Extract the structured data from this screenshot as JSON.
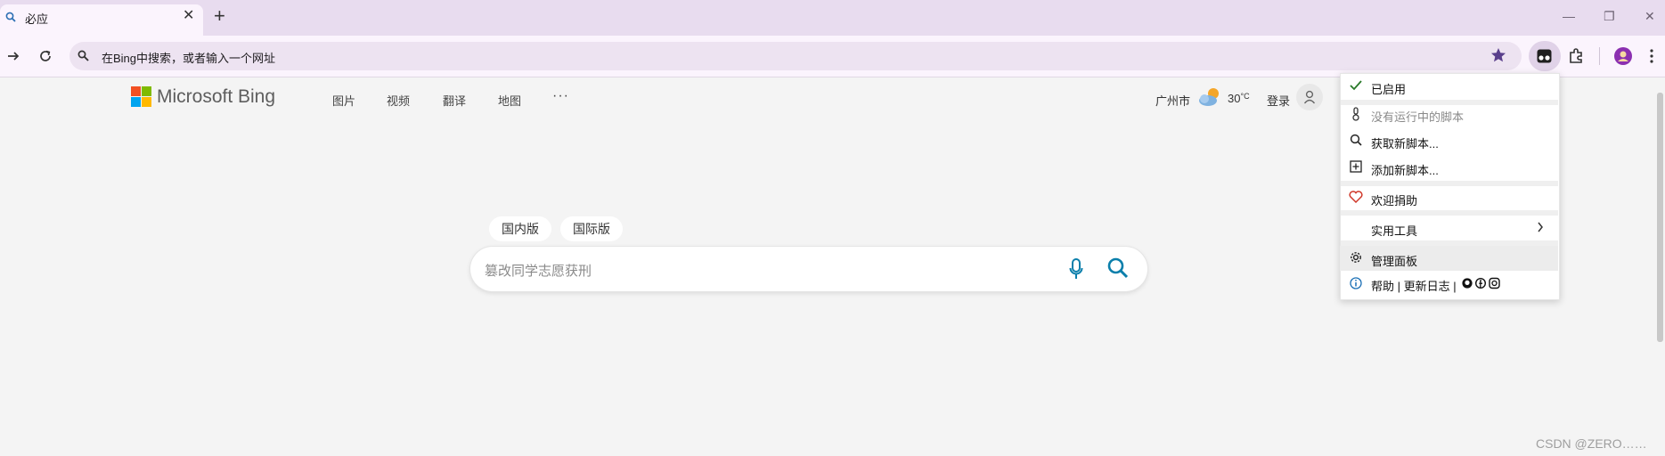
{
  "tab": {
    "title": "必应",
    "close": "✕"
  },
  "new_tab": "+",
  "window_controls": {
    "minimize": "—",
    "restore": "❐",
    "close": "✕"
  },
  "omnibox": {
    "text": "在Bing中搜索，或者输入一个网址"
  },
  "bing": {
    "brand": "Microsoft Bing",
    "nav": [
      "图片",
      "视频",
      "翻译",
      "地图",
      "···"
    ],
    "city": "广州市",
    "temp": "30",
    "temp_unit": "°C",
    "login": "登录",
    "scopes": [
      "国内版",
      "国际版"
    ],
    "search_placeholder": "篡改同学志愿获刑"
  },
  "menu": {
    "enabled": "已启用",
    "no_scripts": "没有运行中的脚本",
    "get_scripts": "获取新脚本...",
    "add_script": "添加新脚本...",
    "donate": "欢迎捐助",
    "utilities": "实用工具",
    "dashboard": "管理面板",
    "help": "帮助",
    "sep1": "|",
    "changelog": "更新日志",
    "sep2": "|"
  },
  "watermark": "CSDN @ZERO……",
  "colors": {
    "accent": "#0b7fab",
    "tabstrip": "#e8dcef",
    "toolbar": "#fbf4fd"
  }
}
